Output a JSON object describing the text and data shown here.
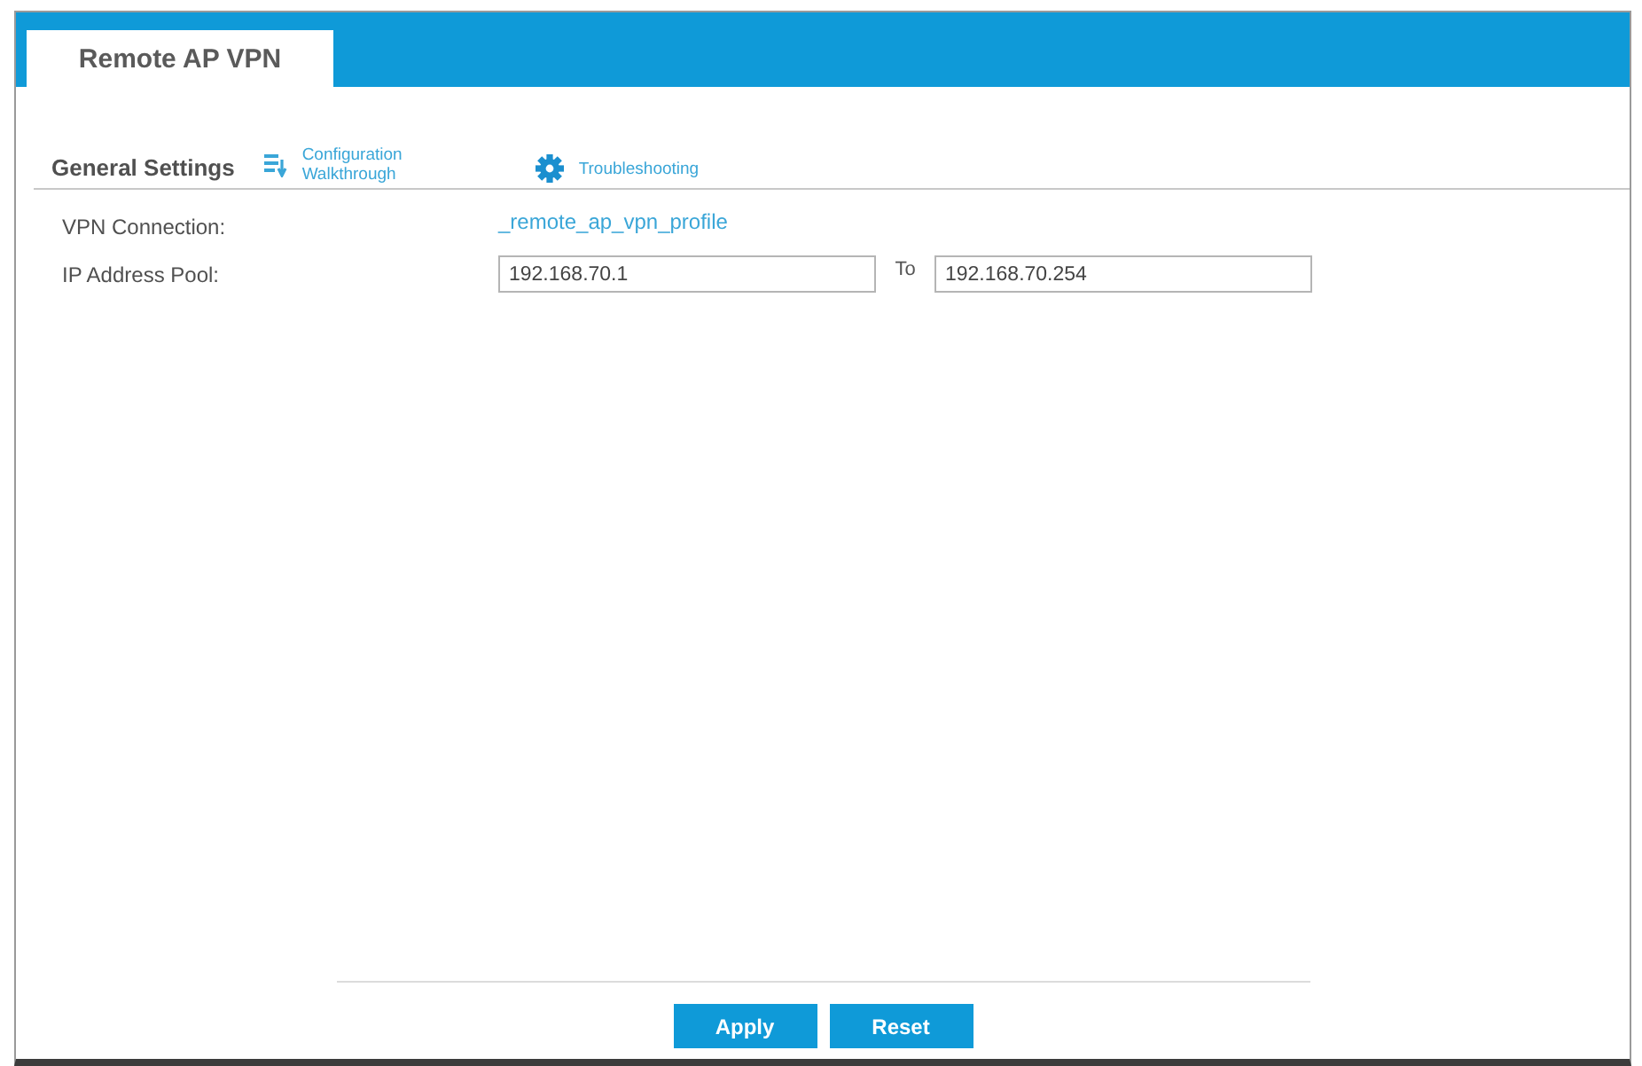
{
  "tabs": [
    {
      "label": "Remote AP VPN",
      "selected": true
    }
  ],
  "section": {
    "title": "General Settings",
    "links": [
      {
        "kind": "walkthrough",
        "label": "Configuration Walkthrough"
      },
      {
        "kind": "troubleshooting",
        "label": "Troubleshooting"
      }
    ]
  },
  "fields": [
    {
      "kind": "link",
      "label": "VPN Connection:",
      "value": "_remote_ap_vpn_profile"
    },
    {
      "kind": "range",
      "label": "IP Address Pool:",
      "from": "192.168.70.1",
      "separator": "To",
      "to": "192.168.70.254"
    }
  ],
  "buttons": [
    "Apply",
    "Reset"
  ]
}
